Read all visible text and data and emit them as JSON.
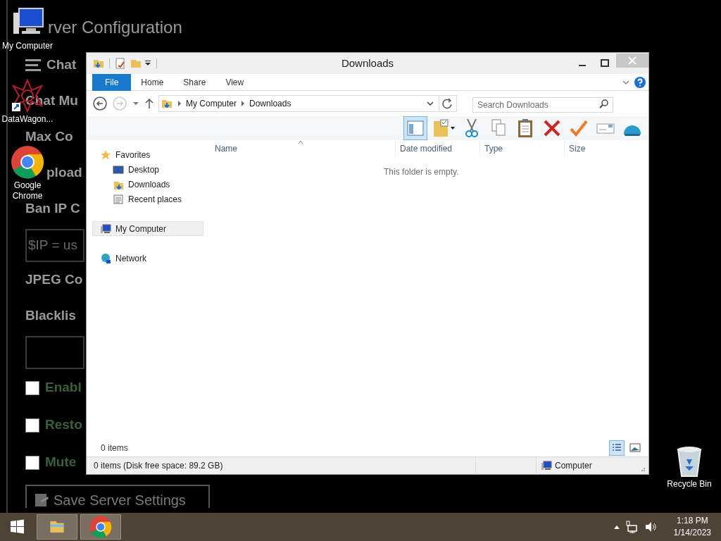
{
  "background_app": {
    "title": "rver Configuration",
    "items": [
      {
        "kind": "heading",
        "text": "Chat",
        "icon": true
      },
      {
        "kind": "heading",
        "text": "Chat Mu"
      },
      {
        "kind": "heading",
        "text": "Max Co"
      },
      {
        "kind": "heading",
        "text": "pload"
      },
      {
        "kind": "heading",
        "text": "Ban IP C"
      },
      {
        "kind": "field",
        "value": "$IP = us"
      },
      {
        "kind": "heading",
        "text": "JPEG Co"
      },
      {
        "kind": "heading",
        "text": "Blacklis"
      },
      {
        "kind": "field"
      },
      {
        "kind": "checkbox",
        "label": "Enabl",
        "checked": false
      },
      {
        "kind": "checkbox",
        "label": "Resto",
        "checked": false
      },
      {
        "kind": "checkbox",
        "label": "Mute",
        "checked": false
      }
    ],
    "button": "Save Server Settings"
  },
  "desktop_icons": [
    {
      "kind": "computer",
      "label": "My Computer"
    },
    {
      "kind": "app",
      "label": "DataWagon..."
    },
    {
      "kind": "browser",
      "label": "Google Chrome"
    },
    {
      "kind": "recycle",
      "label": "Recycle Bin"
    }
  ],
  "explorer": {
    "title": "Downloads",
    "ribbon_tabs": [
      {
        "label": "File",
        "selected": true
      },
      {
        "label": "Home",
        "selected": false
      },
      {
        "label": "Share",
        "selected": false
      },
      {
        "label": "View",
        "selected": false
      }
    ],
    "breadcrumb": [
      "My Computer",
      "Downloads"
    ],
    "search": {
      "placeholder": "Search Downloads"
    },
    "toolbar": [
      {
        "kind": "pane",
        "selected": true
      },
      {
        "kind": "properties",
        "selected": false
      },
      {
        "kind": "cut",
        "selected": false
      },
      {
        "kind": "copy",
        "selected": false
      },
      {
        "kind": "paste",
        "selected": false
      },
      {
        "kind": "delete",
        "selected": false
      },
      {
        "kind": "check",
        "selected": false
      },
      {
        "kind": "rename",
        "selected": false
      },
      {
        "kind": "shell",
        "selected": false
      }
    ],
    "nav": [
      {
        "label": "Favorites",
        "kind": "star",
        "selected": false,
        "children": [
          {
            "label": "Desktop",
            "kind": "desktop",
            "selected": false
          },
          {
            "label": "Downloads",
            "kind": "downloads",
            "selected": false
          },
          {
            "label": "Recent places",
            "kind": "recent",
            "selected": false
          }
        ]
      },
      {
        "label": "My Computer",
        "kind": "computer",
        "selected": true
      },
      {
        "label": "Network",
        "kind": "network",
        "selected": false
      }
    ],
    "columns": [
      "Name",
      "Date modified",
      "Type",
      "Size"
    ],
    "empty_message": "This folder is empty.",
    "item_count": "0 items",
    "view_modes": [
      {
        "kind": "details",
        "selected": true
      },
      {
        "kind": "large_icons",
        "selected": false
      }
    ],
    "status_bar": {
      "text": "0 items (Disk free space: 89.2 GB)",
      "location": "Computer"
    }
  },
  "taskbar": {
    "apps": [
      {
        "kind": "explorer",
        "selected": true
      },
      {
        "kind": "browser",
        "selected": true
      }
    ],
    "time": "1:18 PM",
    "date": "1/14/2023"
  }
}
